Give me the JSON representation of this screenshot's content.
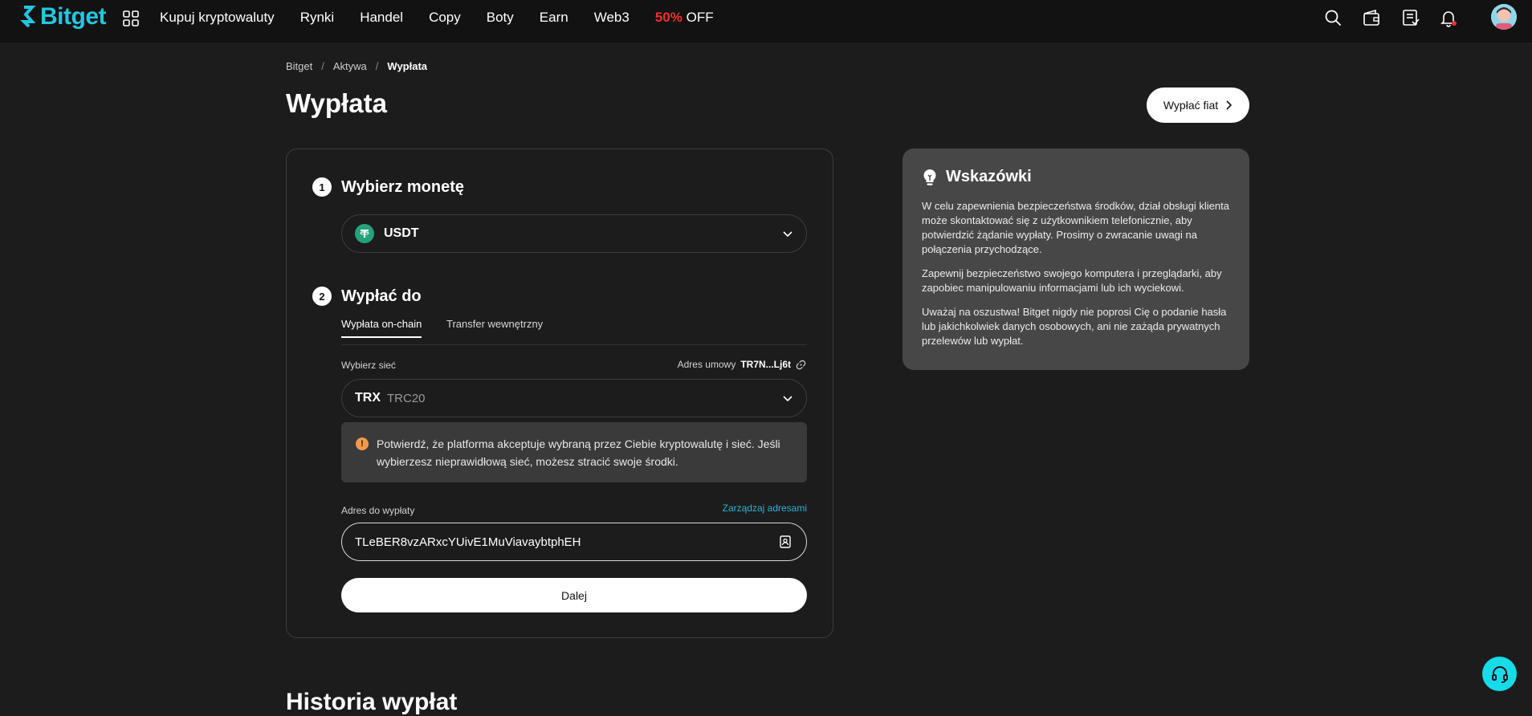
{
  "brand": {
    "name": "Bitget",
    "accent": "#22c7e0"
  },
  "nav": {
    "items": [
      {
        "label": "Kupuj kryptowaluty"
      },
      {
        "label": "Rynki"
      },
      {
        "label": "Handel"
      },
      {
        "label": "Copy"
      },
      {
        "label": "Boty"
      },
      {
        "label": "Earn"
      },
      {
        "label": "Web3"
      }
    ],
    "promo": {
      "percent": "50%",
      "text": "OFF",
      "color": "#f23030"
    },
    "icons": [
      "search-icon",
      "wallet-icon",
      "orders-icon",
      "bell-icon"
    ]
  },
  "breadcrumb": [
    "Bitget",
    "Aktywa",
    "Wypłata"
  ],
  "page": {
    "title": "Wypłata",
    "fiat_button": "Wypłać fiat"
  },
  "step1": {
    "number": "1",
    "title": "Wybierz monetę",
    "coin": "USDT",
    "coin_color": "#26a17b"
  },
  "step2": {
    "number": "2",
    "title": "Wypłać do",
    "tabs": [
      {
        "label": "Wypłata on-chain",
        "active": true
      },
      {
        "label": "Transfer wewnętrzny",
        "active": false
      }
    ],
    "network_label": "Wybierz sieć",
    "contract_label": "Adres umowy",
    "contract_address": "TR7N...Lj6t",
    "network": "TRX",
    "network_sub": "TRC20",
    "warning": "Potwierdź, że platforma akceptuje wybraną przez Ciebie kryptowalutę i sieć. Jeśli wybierzesz nieprawidłową sieć, możesz stracić swoje środki.",
    "address_label": "Adres do wypłaty",
    "manage_link": "Zarządzaj adresami",
    "address_value": "TLeBER8vzARxcYUivE1MuViavaybtphEH",
    "next_button": "Dalej"
  },
  "tips": {
    "title": "Wskazówki",
    "paragraphs": [
      "W celu zapewnienia bezpieczeństwa środków, dział obsługi klienta może skontaktować się z użytkownikiem telefonicznie, aby potwierdzić żądanie wypłaty. Prosimy o zwracanie uwagi na połączenia przychodzące.",
      "Zapewnij bezpieczeństwo swojego komputera i przeglądarki, aby zapobiec manipulowaniu informacjami lub ich wyciekowi.",
      "Uważaj na oszustwa! Bitget nigdy nie poprosi Cię o podanie hasła lub jakichkolwiek danych osobowych, ani nie zażąda prywatnych przelewów lub wypłat."
    ]
  },
  "history": {
    "title": "Historia wypłat"
  }
}
